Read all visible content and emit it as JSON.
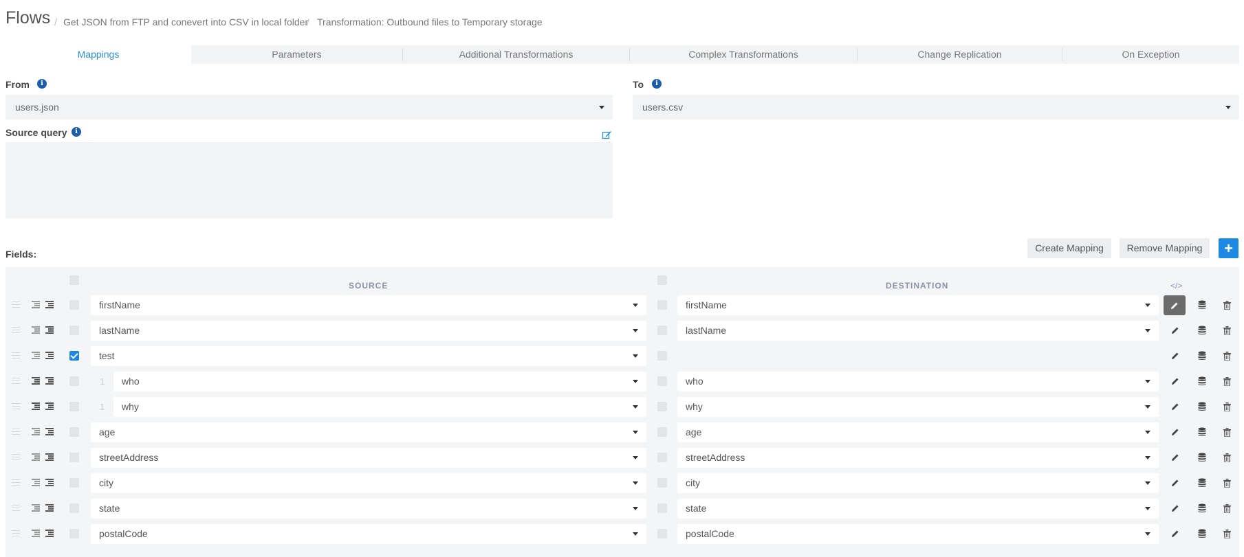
{
  "header": {
    "title": "Flows",
    "breadcrumbs": [
      "Get JSON from FTP and conevert into CSV in local folder",
      "Transformation: Outbound files to Temporary storage"
    ],
    "separator": "/"
  },
  "tabs": [
    {
      "label": "Mappings",
      "active": true
    },
    {
      "label": "Parameters",
      "active": false
    },
    {
      "label": "Additional Transformations",
      "active": false
    },
    {
      "label": "Complex Transformations",
      "active": false
    },
    {
      "label": "Change Replication",
      "active": false
    },
    {
      "label": "On Exception",
      "active": false
    }
  ],
  "form": {
    "from_label": "From",
    "from_value": "users.json",
    "to_label": "To",
    "to_value": "users.csv",
    "source_query_label": "Source query",
    "source_query_value": ""
  },
  "fields": {
    "label": "Fields:",
    "create_mapping": "Create Mapping",
    "remove_mapping": "Remove Mapping",
    "add_symbol": "+",
    "source_header": "SOURCE",
    "destination_header": "DESTINATION",
    "code_icon": "</>"
  },
  "rows": [
    {
      "source": "firstName",
      "destination": "firstName",
      "level": "",
      "checked": false
    },
    {
      "source": "lastName",
      "destination": "lastName",
      "level": "",
      "checked": false
    },
    {
      "source": "test",
      "destination": "",
      "level": "",
      "checked": true
    },
    {
      "source": "who",
      "destination": "who",
      "level": "1",
      "checked": false
    },
    {
      "source": "why",
      "destination": "why",
      "level": "1",
      "checked": false
    },
    {
      "source": "age",
      "destination": "age",
      "level": "",
      "checked": false
    },
    {
      "source": "streetAddress",
      "destination": "streetAddress",
      "level": "",
      "checked": false
    },
    {
      "source": "city",
      "destination": "city",
      "level": "",
      "checked": false
    },
    {
      "source": "state",
      "destination": "state",
      "level": "",
      "checked": false
    },
    {
      "source": "postalCode",
      "destination": "postalCode",
      "level": "",
      "checked": false
    }
  ],
  "colors": {
    "accent": "#1e88e5",
    "info_icon": "#1b5da8",
    "active_tab_text": "#2a8fe0",
    "panel_bg": "#f2f3f5"
  }
}
